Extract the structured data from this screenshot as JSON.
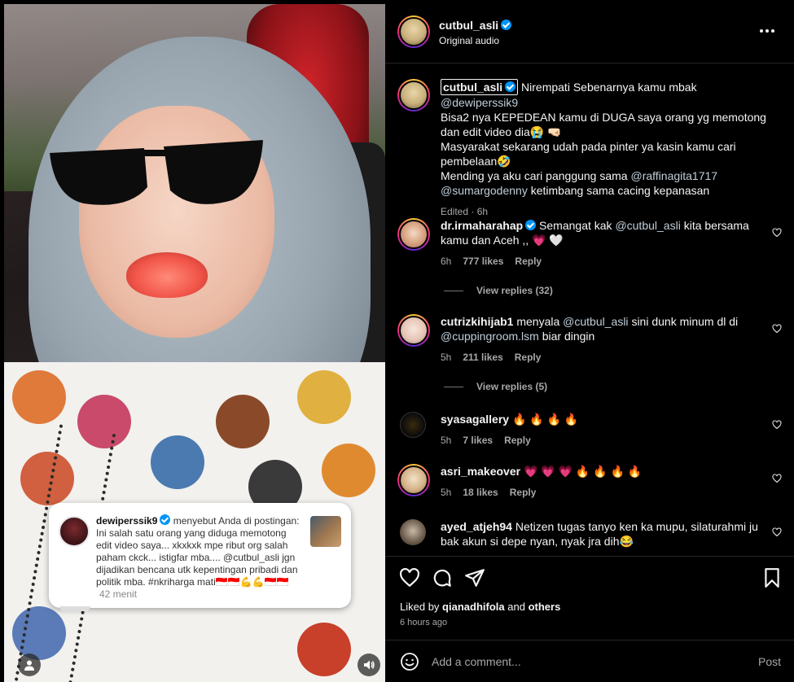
{
  "post": {
    "username": "cutbul_asli",
    "audio": "Original audio",
    "liked_by_prefix": "Liked by",
    "liked_by_user": "qianadhifola",
    "liked_by_suffix": "and",
    "liked_by_others": "others",
    "time_ago": "6 hours ago"
  },
  "caption": {
    "username": "cutbul_asli",
    "text_1": "Nirempati Sebenarnya kamu mbak",
    "mention_1": "@dewiperssik9",
    "text_2": "Bisa2 nya KEPEDEAN kamu di DUGA saya orang yg memotong dan edit video dia😭 🤜🏻",
    "text_3": "Masyarakat sekarang udah pada pinter ya kasin kamu cari pembelaan🤣",
    "text_4": "Mending ya aku cari panggung sama",
    "mention_2": "@raffinagita1717",
    "mention_3": "@sumargodenny",
    "text_5": "ketimbang sama cacing kepanasan",
    "meta": "Edited · 6h"
  },
  "comments": [
    {
      "username": "dr.irmaharahap",
      "verified": true,
      "text_pre": "Semangat kak",
      "mention": "@cutbul_asli",
      "text_post": "kita bersama kamu dan Aceh ,, 💗 🤍",
      "time": "6h",
      "likes": "777 likes",
      "reply": "Reply",
      "view_replies": "View replies (32)"
    },
    {
      "username": "cutrizkihijab1",
      "verified": false,
      "text_pre": "menyala",
      "mention": "@cutbul_asli",
      "text_mid": "sini dunk minum dl di",
      "mention_2": "@cuppingroom.lsm",
      "text_post": "biar dingin",
      "time": "5h",
      "likes": "211 likes",
      "reply": "Reply",
      "view_replies": "View replies (5)"
    },
    {
      "username": "syasagallery",
      "text": "🔥 🔥 🔥 🔥",
      "time": "5h",
      "likes": "7 likes",
      "reply": "Reply"
    },
    {
      "username": "asri_makeover",
      "text": "💗 💗 💗 🔥 🔥 🔥 🔥",
      "time": "5h",
      "likes": "18 likes",
      "reply": "Reply"
    },
    {
      "username": "ayed_atjeh94",
      "text": "Netizen tugas tanyo ken ka mupu, silaturahmi ju bak akun si depe nyan, nyak jra dih😂"
    }
  ],
  "mention_card": {
    "username": "dewiperssik9",
    "text": "menyebut Anda di postingan: Ini salah satu orang yang diduga memotong edit video saya... xkxkxk mpe ribut org salah paham ckck... istigfar mba.... @cutbul_asli jgn dijadikan bencana utk kepentingan pribadi dan politik mba. #nkriharga mati🇮🇩🇮🇩💪💪🇮🇩🇮🇩",
    "time": "42 menit"
  },
  "composer": {
    "placeholder": "Add a comment...",
    "post_label": "Post"
  },
  "icons": {
    "more": "more-horizontal-icon",
    "like": "heart-icon",
    "comment": "comment-icon",
    "share": "share-icon",
    "save": "bookmark-icon",
    "emoji": "emoji-icon",
    "sound": "speaker-icon",
    "tags": "user-tag-icon"
  },
  "colors": {
    "background": "#000000",
    "text": "#f5f5f5",
    "muted": "#a8a8a8",
    "verified": "#0095f6",
    "mention": "#e0f1ff",
    "divider": "#262626"
  }
}
